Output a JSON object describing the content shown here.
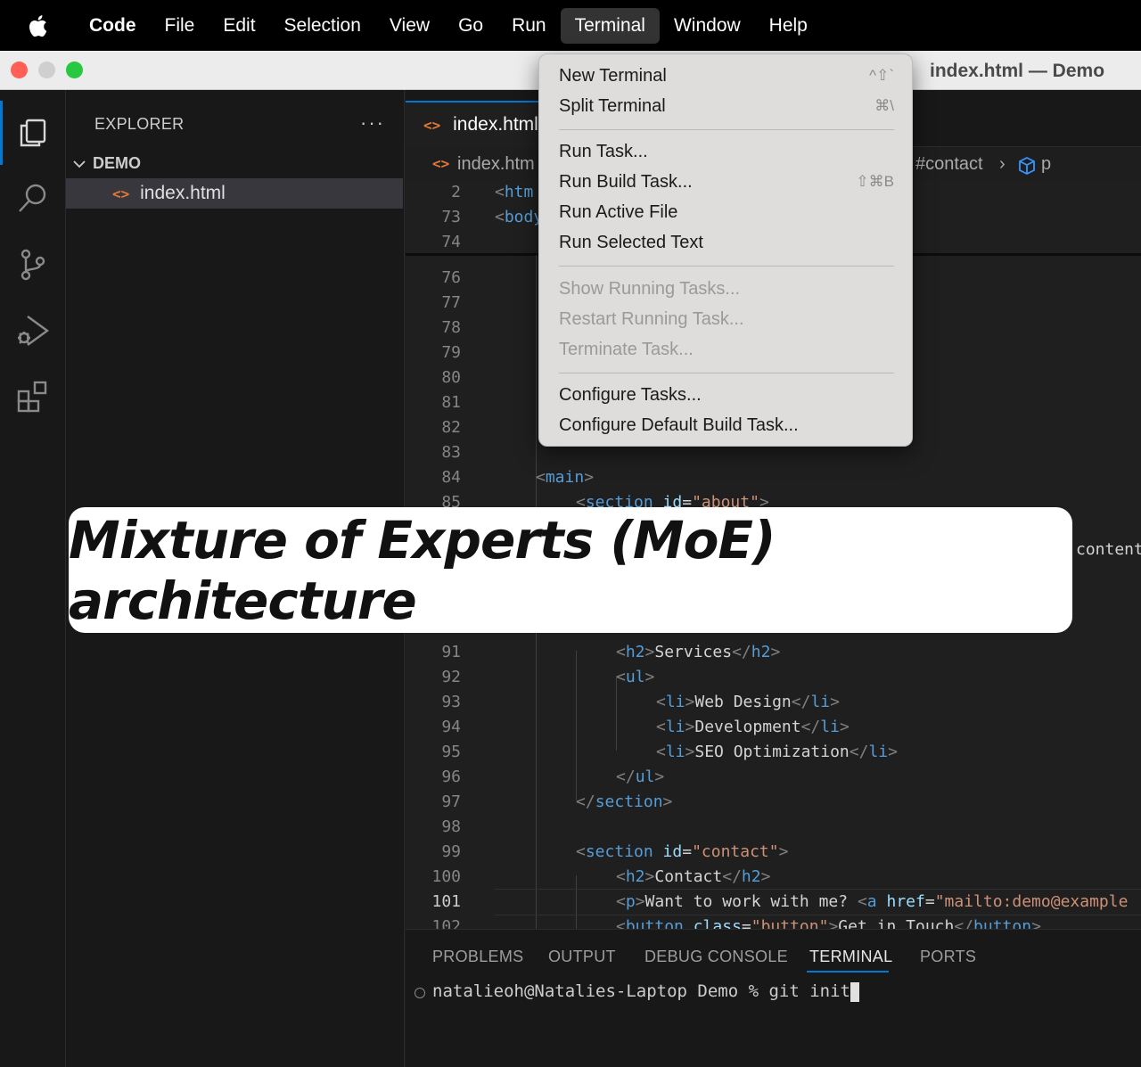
{
  "menubar": {
    "app": "Code",
    "items": [
      "File",
      "Edit",
      "Selection",
      "View",
      "Go",
      "Run",
      "Terminal",
      "Window",
      "Help"
    ],
    "active": "Terminal"
  },
  "window": {
    "title": "index.html — Demo"
  },
  "sidebar": {
    "title": "EXPLORER",
    "more": "···",
    "folder": "DEMO",
    "file": "index.html"
  },
  "tab": {
    "label": "index.html"
  },
  "breadcrumb": {
    "file": "index.htm",
    "section": "#contact",
    "element": "p"
  },
  "editor": {
    "sticky": [
      {
        "n": "2",
        "tag": "htm"
      },
      {
        "n": "73",
        "tag": "body"
      },
      {
        "n": "74"
      }
    ],
    "lines": [
      {
        "n": "76"
      },
      {
        "n": "77"
      },
      {
        "n": "78"
      },
      {
        "n": "79"
      },
      {
        "n": "80"
      },
      {
        "n": "81"
      },
      {
        "n": "82"
      },
      {
        "n": "83"
      },
      {
        "n": "84",
        "code": "main"
      },
      {
        "n": "85",
        "code": "section-about"
      },
      {
        "n": "91",
        "code": "h2-services"
      },
      {
        "n": "92",
        "code": "ul-open"
      },
      {
        "n": "93",
        "code": "li-web"
      },
      {
        "n": "94",
        "code": "li-dev"
      },
      {
        "n": "95",
        "code": "li-seo"
      },
      {
        "n": "96",
        "code": "ul-close"
      },
      {
        "n": "97",
        "code": "section-close"
      },
      {
        "n": "98"
      },
      {
        "n": "99",
        "code": "section-contact"
      },
      {
        "n": "100",
        "code": "h2-contact"
      },
      {
        "n": "101",
        "code": "p-work"
      },
      {
        "n": "102",
        "code": "button"
      }
    ],
    "text": {
      "main": "main",
      "section": "section",
      "id": "id",
      "about": "\"about\"",
      "h2": "h2",
      "services": "Services",
      "ul": "ul",
      "li": "li",
      "web": "Web Design",
      "dev": "Development",
      "seo": "SEO Optimization",
      "contact_val": "\"contact\"",
      "contact": "Contact",
      "p": "p",
      "work": "Want to work with me? ",
      "a": "a",
      "href": "href",
      "mailto": "\"mailto:demo@example",
      "button": "button",
      "class": "class",
      "button_val": "\"button\"",
      "get": "Get in Touch"
    },
    "peek": "content"
  },
  "terminal_menu": {
    "items": [
      {
        "label": "New Terminal",
        "shortcut": "^⇧`",
        "enabled": true
      },
      {
        "label": "Split Terminal",
        "shortcut": "⌘\\",
        "enabled": true
      },
      {
        "label": "Run Task...",
        "shortcut": "",
        "enabled": true
      },
      {
        "label": "Run Build Task...",
        "shortcut": "⇧⌘B",
        "enabled": true
      },
      {
        "label": "Run Active File",
        "shortcut": "",
        "enabled": true
      },
      {
        "label": "Run Selected Text",
        "shortcut": "",
        "enabled": true
      },
      {
        "label": "Show Running Tasks...",
        "shortcut": "",
        "enabled": false
      },
      {
        "label": "Restart Running Task...",
        "shortcut": "",
        "enabled": false
      },
      {
        "label": "Terminate Task...",
        "shortcut": "",
        "enabled": false
      },
      {
        "label": "Configure Tasks...",
        "shortcut": "",
        "enabled": true
      },
      {
        "label": "Configure Default Build Task...",
        "shortcut": "",
        "enabled": true
      }
    ]
  },
  "panel": {
    "tabs": [
      "PROBLEMS",
      "OUTPUT",
      "DEBUG CONSOLE",
      "TERMINAL",
      "PORTS"
    ],
    "active": "TERMINAL",
    "prompt": "natalieoh@Natalies-Laptop Demo % git init"
  },
  "banner": {
    "text": "Mixture of Experts (MoE) architecture"
  },
  "colors": {
    "accent": "#0078d4",
    "tag": "#569cd6",
    "attr": "#9cdcfe",
    "string": "#ce9178"
  }
}
